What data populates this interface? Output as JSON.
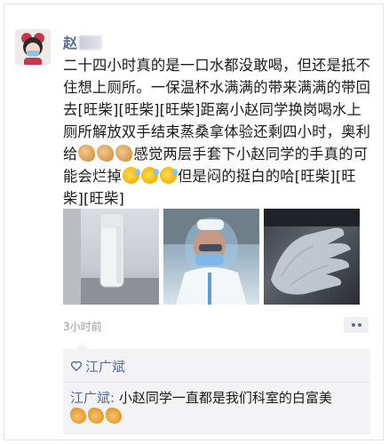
{
  "post": {
    "author": "赵",
    "text_1": "二十四小时真的是一口水都没敢喝，但还是抵不住想上厕所。一保温杯水满满的带来满满的带回去",
    "emote_1": "[旺柴][旺柴][旺柴]",
    "text_2": "距离小赵同学换岗喝水上厕所解放双手结束蒸桑拿体验还剩四小时，奥利给",
    "text_3": "感觉两层手套下小赵同学的手真的可能会烂掉",
    "text_4": "但是闷的挺白的哈",
    "emote_2": "[旺柴][旺柴][旺柴]",
    "time": "3小时前"
  },
  "likes": {
    "names": "江广斌"
  },
  "comments": [
    {
      "author": "江广斌",
      "separator": ": ",
      "text": "小赵同学一直都是我们科室的白富美"
    }
  ],
  "icons": {
    "avatar": "avatar-girl-face-mask",
    "strong_emoji": "flexed-biceps-icon",
    "sweat_emoji": "sweat-smile-icon",
    "like": "heart-outline-icon",
    "thumbs_up": "thumbs-up-icon",
    "more": "more-dots-icon"
  },
  "colors": {
    "link": "#576b95",
    "text": "#1a1a1a",
    "time": "#9b9b9b",
    "comment_bg": "#f3f3f5"
  }
}
